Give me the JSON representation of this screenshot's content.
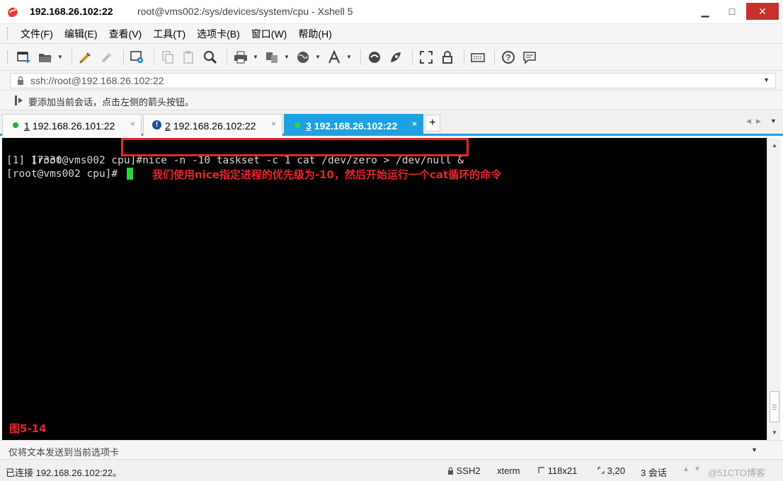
{
  "window": {
    "title_host": "192.168.26.102:22",
    "title_path": "root@vms002:/sys/devices/system/cpu - Xshell 5",
    "minimize_glyph": "▁",
    "maximize_glyph": "□",
    "close_glyph": "✕"
  },
  "menu": {
    "items": [
      "文件(F)",
      "编辑(E)",
      "查看(V)",
      "工具(T)",
      "选项卡(B)",
      "窗口(W)",
      "帮助(H)"
    ]
  },
  "toolbar": {
    "icons": [
      "new-session-icon",
      "open-folder-icon",
      "reconnect-icon",
      "disconnect-icon",
      "session-properties-icon",
      "copy-icon",
      "paste-icon",
      "find-icon",
      "print-icon",
      "transfer-icon",
      "globe-icon",
      "font-icon",
      "xftp-icon",
      "script-icon",
      "fullscreen-icon",
      "lock-icon",
      "keyboard-icon",
      "help-icon",
      "chat-icon"
    ]
  },
  "address": {
    "value": "ssh://root@192.168.26.102:22"
  },
  "hint": {
    "text": "要添加当前会话，点击左侧的箭头按钮。"
  },
  "tabs": [
    {
      "num": "1",
      "label": "192.168.26.101:22",
      "status": "connected"
    },
    {
      "num": "2",
      "label": "192.168.26.102:22",
      "status": "warning"
    },
    {
      "num": "3",
      "label": "192.168.26.102:22",
      "status": "connected",
      "active": true
    }
  ],
  "tab_add": "+",
  "tab_close": "×",
  "terminal": {
    "prompt1": "[root@vms002 cpu]#",
    "command": "nice -n -10 taskset -c 1 cat /dev/zero > /dev/null &",
    "output1": "[1] 17330",
    "prompt2": "[root@vms002 cpu]#",
    "annotation": "我们使用nice指定进程的优先级为-10，然后开始运行一个cat循环的命令",
    "figure_label": "图5-14"
  },
  "compose": {
    "text": "仅将文本发送到当前选项卡"
  },
  "status": {
    "connection": "已连接 192.168.26.102:22。",
    "protocol": "SSH2",
    "term": "xterm",
    "size": "118x21",
    "cursor_pos": "3,20",
    "sessions": "3 会话",
    "watermark": "@51CTO博客"
  },
  "colors": {
    "accent": "#1ea1e0",
    "annotation": "#e8262a",
    "cursor": "#22d63c"
  }
}
